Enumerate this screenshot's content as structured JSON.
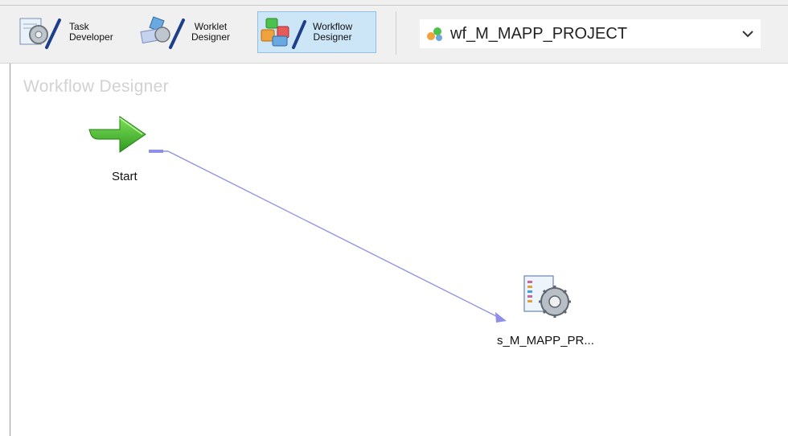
{
  "toolbar": {
    "task_developer_label": "Task\nDeveloper",
    "worklet_designer_label": "Worklet\nDesigner",
    "workflow_designer_label": "Workflow\nDesigner",
    "workflow_selector_value": "wf_M_MAPP_PROJECT"
  },
  "canvas": {
    "title": "Workflow Designer",
    "start_label": "Start",
    "session_label": "s_M_MAPP_PR..."
  },
  "colors": {
    "active_button_bg": "#cde6f7",
    "link_color": "#8f8fe8",
    "start_arrow": "#3fae2a"
  }
}
